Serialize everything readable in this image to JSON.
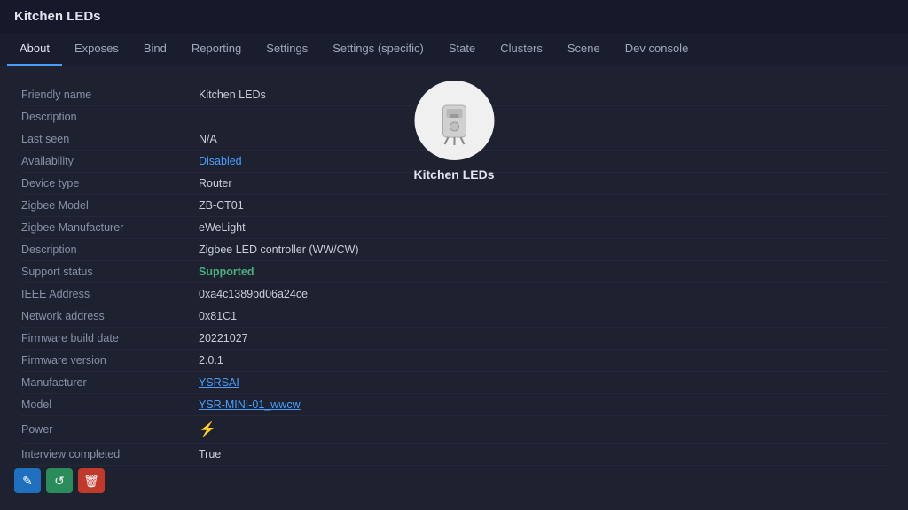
{
  "app": {
    "title": "Kitchen LEDs"
  },
  "nav": {
    "tabs": [
      {
        "label": "About",
        "active": true
      },
      {
        "label": "Exposes",
        "active": false
      },
      {
        "label": "Bind",
        "active": false
      },
      {
        "label": "Reporting",
        "active": false
      },
      {
        "label": "Settings",
        "active": false
      },
      {
        "label": "Settings (specific)",
        "active": false
      },
      {
        "label": "State",
        "active": false
      },
      {
        "label": "Clusters",
        "active": false
      },
      {
        "label": "Scene",
        "active": false
      },
      {
        "label": "Dev console",
        "active": false
      }
    ]
  },
  "device": {
    "name": "Kitchen LEDs",
    "fields": [
      {
        "label": "Friendly name",
        "value": "Kitchen LEDs",
        "type": "normal"
      },
      {
        "label": "Description",
        "value": "",
        "type": "normal"
      },
      {
        "label": "Last seen",
        "value": "N/A",
        "type": "normal"
      },
      {
        "label": "Availability",
        "value": "Disabled",
        "type": "disabled"
      },
      {
        "label": "Device type",
        "value": "Router",
        "type": "normal"
      },
      {
        "label": "Zigbee Model",
        "value": "ZB-CT01",
        "type": "normal"
      },
      {
        "label": "Zigbee Manufacturer",
        "value": "eWeLight",
        "type": "normal"
      },
      {
        "label": "Description",
        "value": "Zigbee LED controller (WW/CW)",
        "type": "normal"
      },
      {
        "label": "Support status",
        "value": "Supported",
        "type": "green"
      },
      {
        "label": "IEEE Address",
        "value": "0xa4c1389bd06a24ce",
        "type": "normal"
      },
      {
        "label": "Network address",
        "value": "0x81C1",
        "type": "normal"
      },
      {
        "label": "Firmware build date",
        "value": "20221027",
        "type": "normal"
      },
      {
        "label": "Firmware version",
        "value": "2.0.1",
        "type": "normal"
      },
      {
        "label": "Manufacturer",
        "value": "YSRSAI",
        "type": "link"
      },
      {
        "label": "Model",
        "value": "YSR-MINI-01_wwcw",
        "type": "link"
      },
      {
        "label": "Power",
        "value": "⚡",
        "type": "icon"
      },
      {
        "label": "Interview completed",
        "value": "True",
        "type": "normal"
      }
    ]
  },
  "actions": {
    "edit_label": "✎",
    "refresh_label": "↺",
    "delete_label": "🗑"
  }
}
